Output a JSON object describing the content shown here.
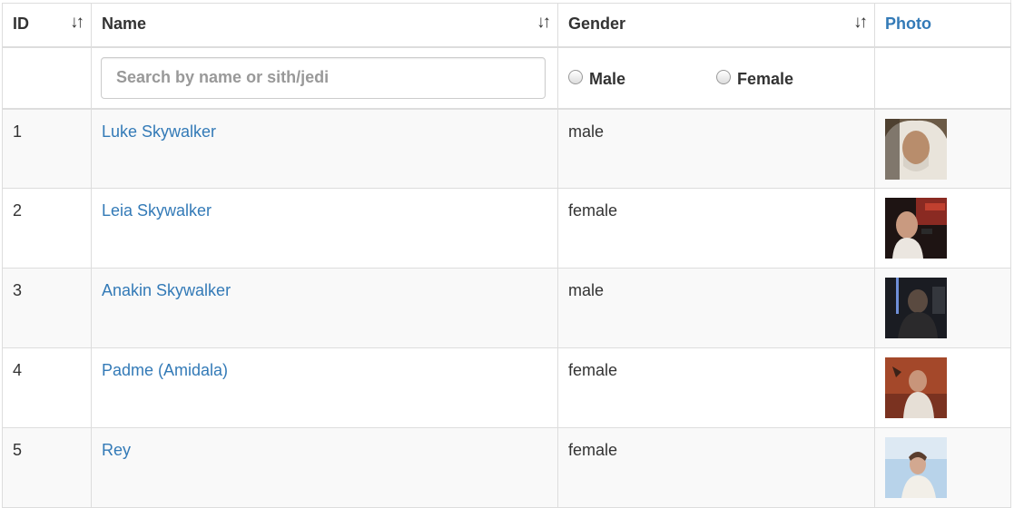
{
  "table": {
    "headers": {
      "id": "ID",
      "name": "Name",
      "gender": "Gender",
      "photo": "Photo"
    },
    "sort_icon": "sort-icon",
    "filter": {
      "search_placeholder": "Search by name or sith/jedi",
      "male_label": "Male",
      "female_label": "Female"
    },
    "rows": [
      {
        "id": "1",
        "name": "Luke Skywalker",
        "gender": "male"
      },
      {
        "id": "2",
        "name": "Leia Skywalker",
        "gender": "female"
      },
      {
        "id": "3",
        "name": "Anakin Skywalker",
        "gender": "male"
      },
      {
        "id": "4",
        "name": "Padme (Amidala)",
        "gender": "female"
      },
      {
        "id": "5",
        "name": "Rey",
        "gender": "female"
      }
    ]
  },
  "colors": {
    "link": "#337ab7",
    "border": "#dddddd",
    "stripe": "#f9f9f9"
  }
}
